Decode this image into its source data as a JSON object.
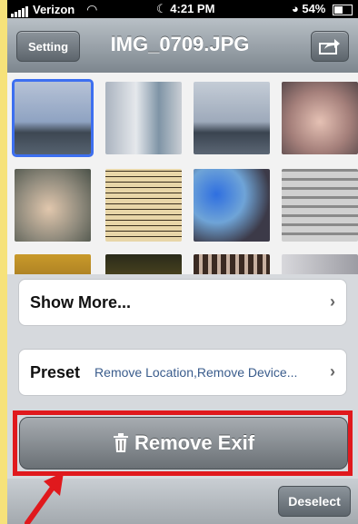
{
  "status_bar": {
    "carrier": "Verizon",
    "time": "4:21 PM",
    "battery": "54%"
  },
  "nav": {
    "setting_label": "Setting",
    "title": "IMG_0709.JPG",
    "share_icon": "share-icon"
  },
  "rows": {
    "show_more": {
      "label": "Show More..."
    },
    "preset": {
      "label": "Preset",
      "value": "Remove Location,Remove Device..."
    }
  },
  "remove_button": {
    "label": "Remove Exif",
    "icon": "trash-icon"
  },
  "deselect_label": "Deselect",
  "colors": {
    "accent_selection": "#3d6ff0",
    "annotation_red": "#e0191d",
    "background_yellow": "#f6e27a"
  }
}
